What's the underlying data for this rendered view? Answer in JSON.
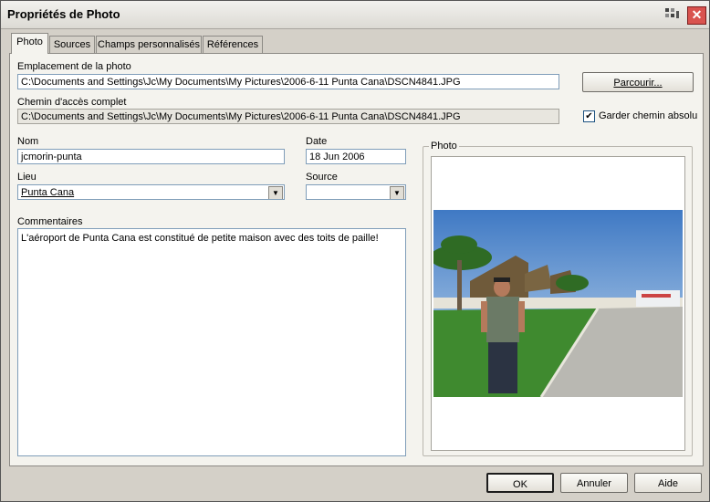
{
  "window": {
    "title": "Propriétés de Photo",
    "close_label": "✕"
  },
  "tabs": [
    {
      "label": "Photo",
      "active": true
    },
    {
      "label": "Sources",
      "active": false
    },
    {
      "label": "Champs personnalisés",
      "active": false
    },
    {
      "label": "Références",
      "active": false
    }
  ],
  "form": {
    "emplacement_label": "Emplacement de la photo",
    "emplacement_value": "C:\\Documents and Settings\\Jc\\My Documents\\My Pictures\\2006-6-11 Punta Cana\\DSCN4841.JPG",
    "parcourir_label": "Parcourir...",
    "chemin_label": "Chemin d'accès complet",
    "chemin_value": "C:\\Documents and Settings\\Jc\\My Documents\\My Pictures\\2006-6-11 Punta Cana\\DSCN4841.JPG",
    "garder_label": "Garder chemin absolu",
    "garder_checked": true,
    "nom_label": "Nom",
    "nom_value": "jcmorin-punta",
    "date_label": "Date",
    "date_value": "18 Jun 2006",
    "lieu_label": "Lieu",
    "lieu_value": "Punta Cana",
    "source_label": "Source",
    "source_value": "",
    "commentaires_label": "Commentaires",
    "commentaires_value": "L'aéroport de Punta Cana est constitué de petite maison avec des toits de paille!",
    "photo_group_label": "Photo"
  },
  "buttons": {
    "ok": "OK",
    "annuler": "Annuler",
    "aide": "Aide"
  },
  "colors": {
    "sky": "#5f93cf",
    "grass": "#3f8a2f",
    "road": "#b9b8b2"
  }
}
